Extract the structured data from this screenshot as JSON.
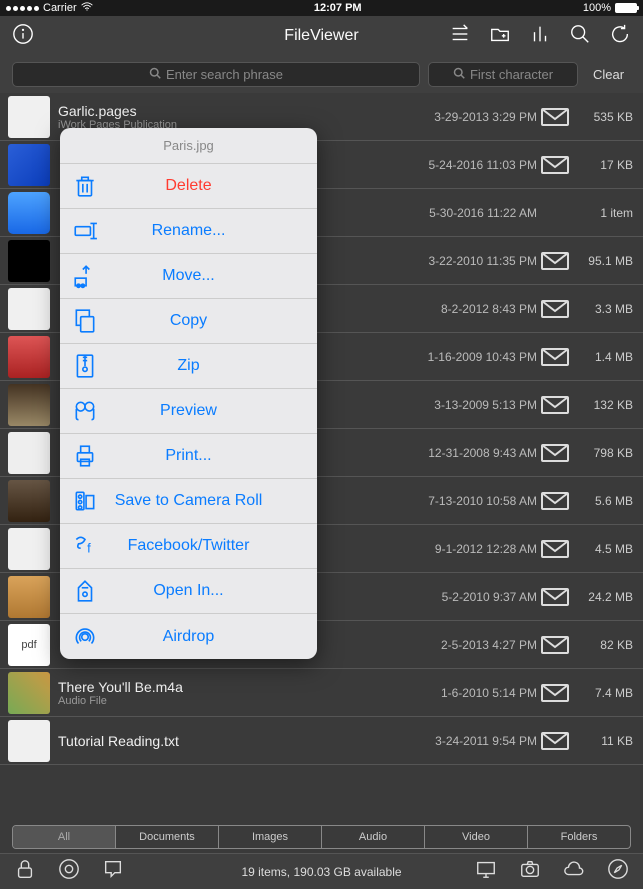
{
  "status": {
    "carrier": "Carrier",
    "time": "12:07 PM",
    "battery_pct": "100%"
  },
  "nav_title": "FileViewer",
  "search": {
    "placeholder": "Enter search phrase",
    "first_char": "First character",
    "clear": "Clear"
  },
  "popup": {
    "title": "Paris.jpg",
    "items": [
      {
        "label": "Delete",
        "icon": "trash",
        "danger": true
      },
      {
        "label": "Rename...",
        "icon": "rename"
      },
      {
        "label": "Move...",
        "icon": "move"
      },
      {
        "label": "Copy",
        "icon": "copy"
      },
      {
        "label": "Zip",
        "icon": "zip"
      },
      {
        "label": "Preview",
        "icon": "preview"
      },
      {
        "label": "Print...",
        "icon": "print"
      },
      {
        "label": "Save to Camera Roll",
        "icon": "camera-roll"
      },
      {
        "label": "Facebook/Twitter",
        "icon": "social"
      },
      {
        "label": "Open In...",
        "icon": "open-in"
      },
      {
        "label": "Airdrop",
        "icon": "airdrop"
      }
    ]
  },
  "files": [
    {
      "name": "Garlic.pages",
      "sub": "iWork Pages Publication",
      "date": "3-29-2013 3:29 PM",
      "mail": true,
      "size": "535 KB",
      "th": "th-doc"
    },
    {
      "name": "",
      "sub": "",
      "date": "5-24-2016 11:03 PM",
      "mail": true,
      "size": "17 KB",
      "th": "th-xcode"
    },
    {
      "name": "",
      "sub": "",
      "date": "5-30-2016 11:22 AM",
      "mail": false,
      "size": "1 item",
      "th": "th-folder"
    },
    {
      "name": "",
      "sub": "",
      "date": "3-22-2010 11:35 PM",
      "mail": true,
      "size": "95.1 MB",
      "th": "th-dark"
    },
    {
      "name": "",
      "sub": "",
      "date": "8-2-2012 8:43 PM",
      "mail": true,
      "size": "3.3 MB",
      "th": "th-doc"
    },
    {
      "name": "",
      "sub": "",
      "date": "1-16-2009 10:43 PM",
      "mail": true,
      "size": "1.4 MB",
      "th": "th-red"
    },
    {
      "name": "",
      "sub": "",
      "date": "3-13-2009 5:13 PM",
      "mail": true,
      "size": "132 KB",
      "th": "th-city"
    },
    {
      "name": "",
      "sub": "",
      "date": "12-31-2008 9:43 AM",
      "mail": true,
      "size": "798 KB",
      "th": "th-text"
    },
    {
      "name": "",
      "sub": "",
      "date": "7-13-2010 10:58 AM",
      "mail": true,
      "size": "5.6 MB",
      "th": "th-face"
    },
    {
      "name": "",
      "sub": "",
      "date": "9-1-2012 12:28 AM",
      "mail": true,
      "size": "4.5 MB",
      "th": "th-doc"
    },
    {
      "name": "",
      "sub": "",
      "date": "5-2-2010 9:37 AM",
      "mail": true,
      "size": "24.2 MB",
      "th": "th-pkg"
    },
    {
      "name": "",
      "sub": "",
      "date": "2-5-2013 4:27 PM",
      "mail": true,
      "size": "82 KB",
      "th": "th-pdf",
      "pdf": "pdf"
    },
    {
      "name": "There You'll Be.m4a",
      "sub": "Audio File",
      "date": "1-6-2010 5:14 PM",
      "mail": true,
      "size": "7.4 MB",
      "th": "th-photo"
    },
    {
      "name": "Tutorial Reading.txt",
      "sub": "",
      "date": "3-24-2011 9:54 PM",
      "mail": true,
      "size": "11 KB",
      "th": "th-doc"
    }
  ],
  "filters": [
    "All",
    "Documents",
    "Images",
    "Audio",
    "Video",
    "Folders"
  ],
  "active_filter": 0,
  "bottom_status": "19 items, 190.03 GB available"
}
